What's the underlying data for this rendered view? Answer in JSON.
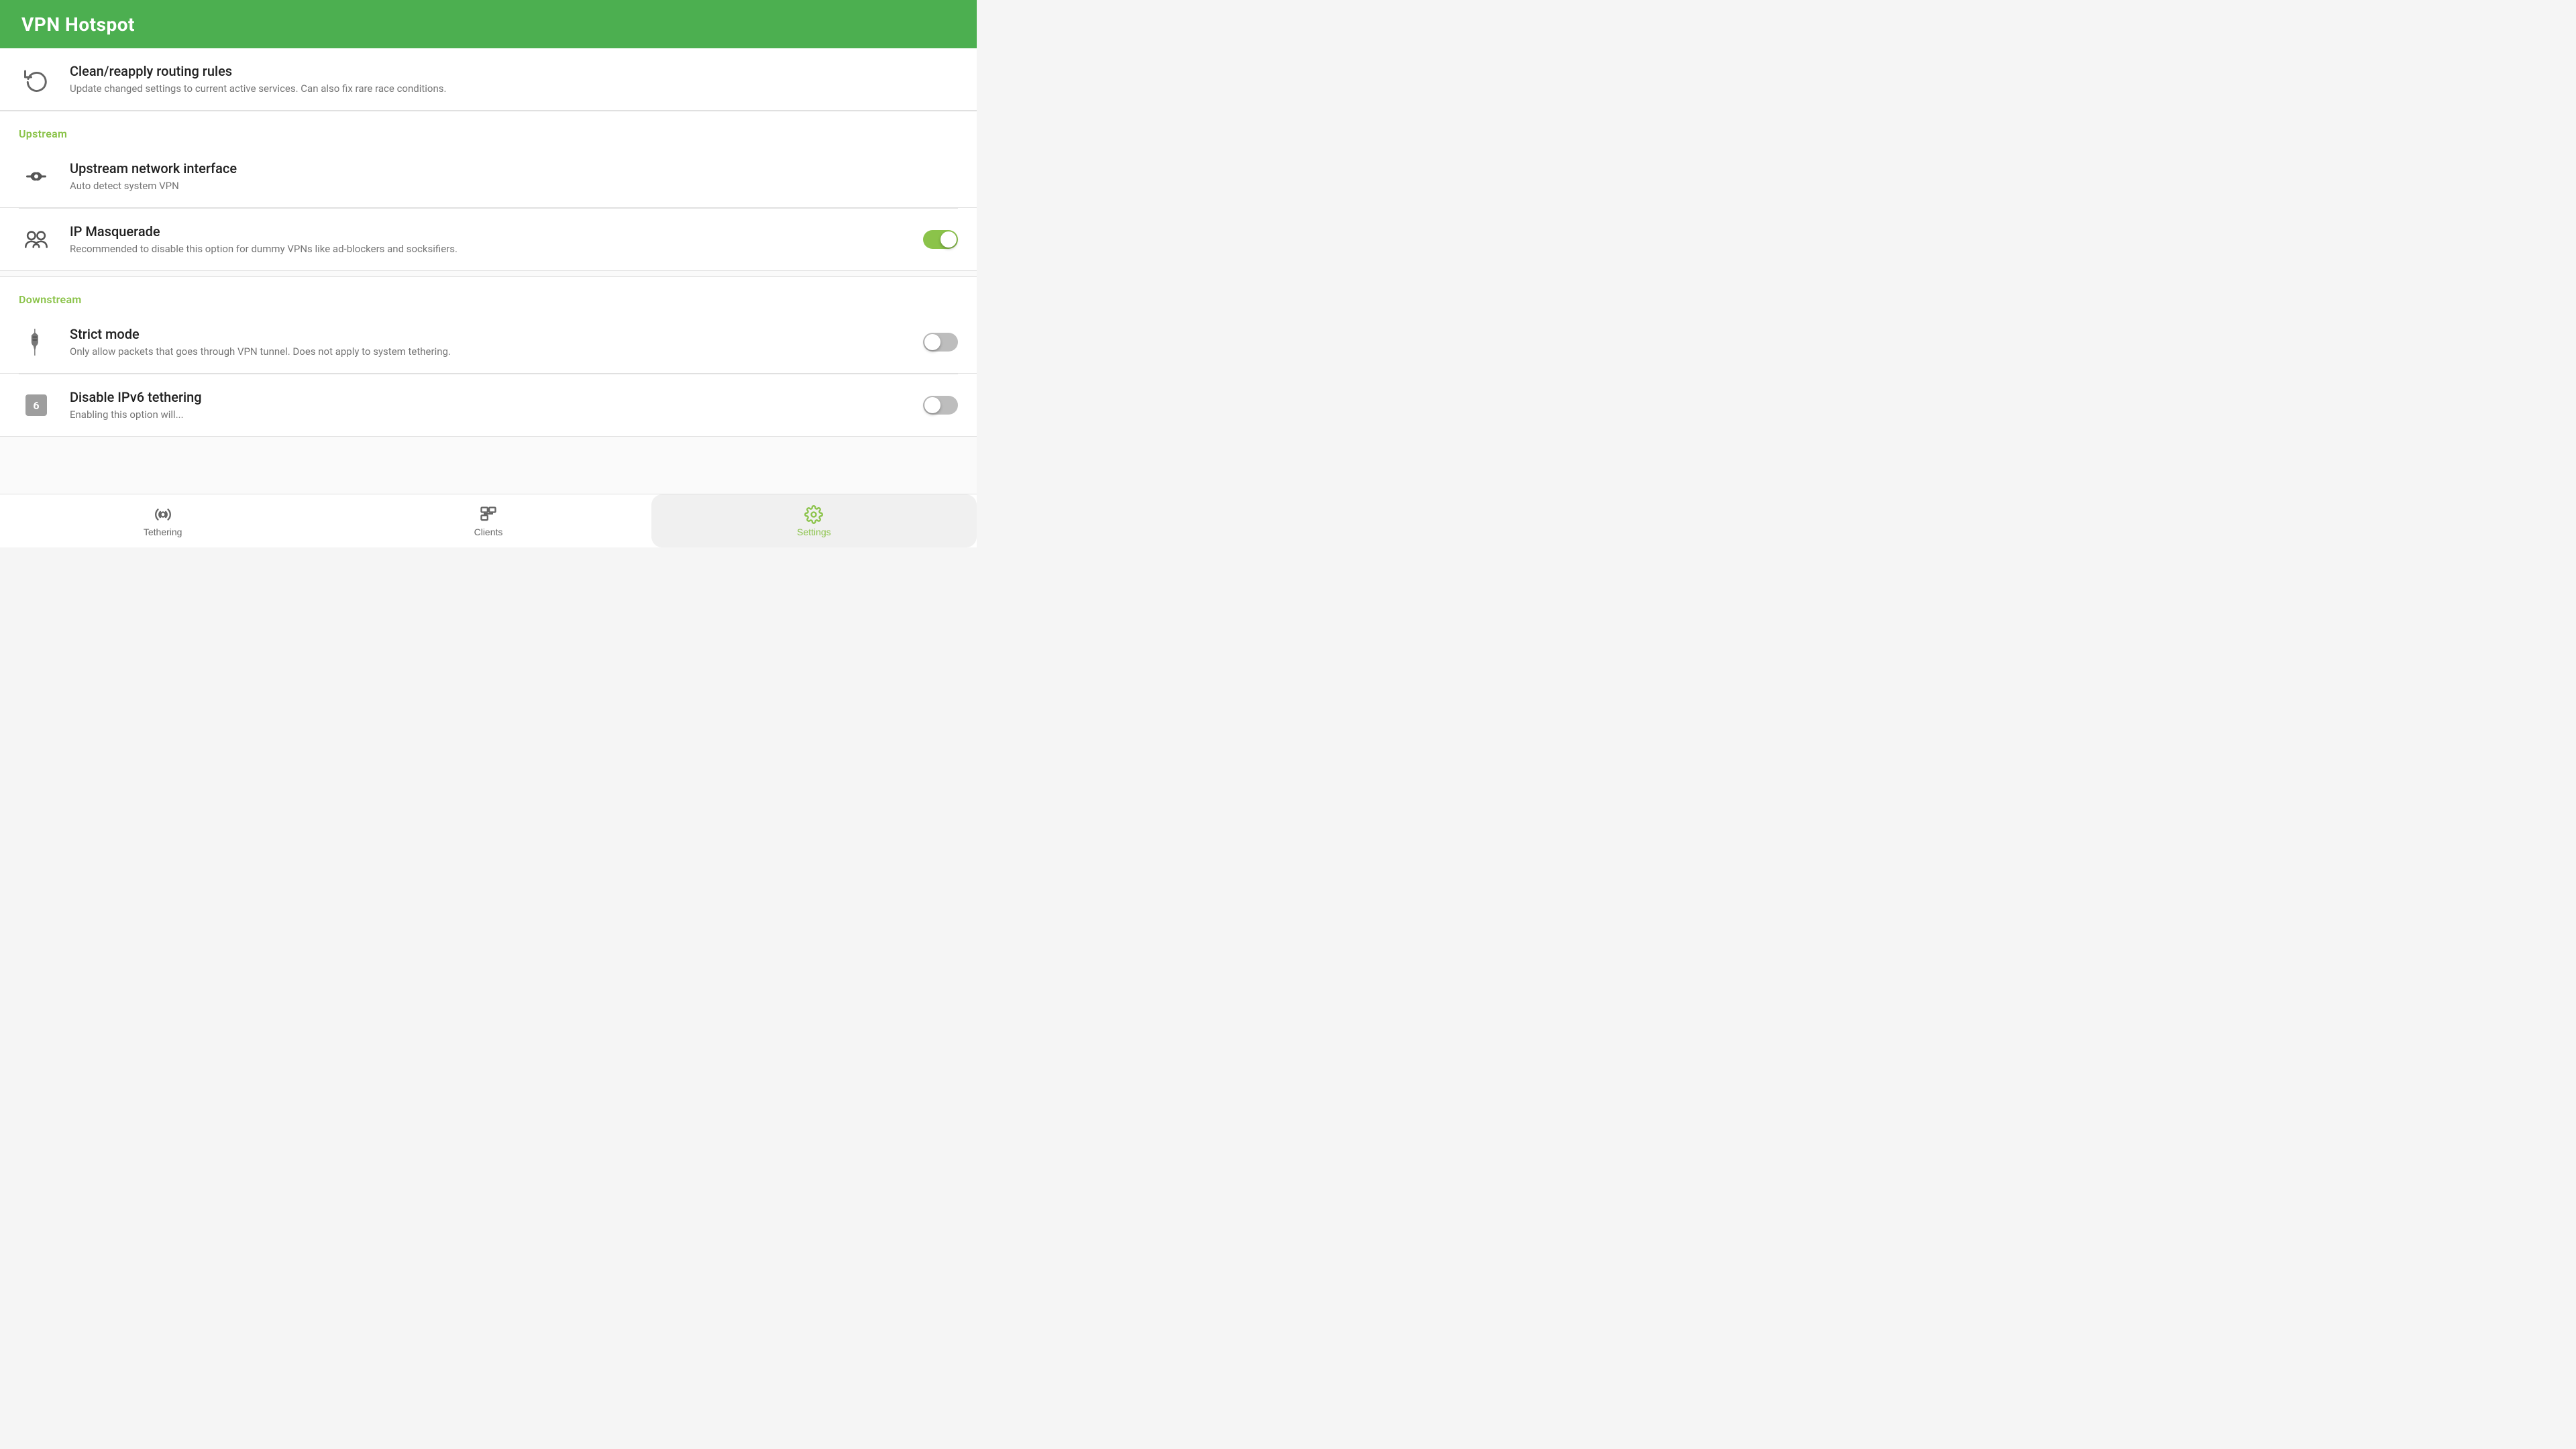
{
  "appBar": {
    "title": "VPN Hotspot"
  },
  "listItems": {
    "cleanReapply": {
      "title": "Clean/reapply routing rules",
      "subtitle": "Update changed settings to current active services. Can also fix rare race conditions."
    },
    "upstream": {
      "sectionTitle": "Upstream",
      "networkInterface": {
        "title": "Upstream network interface",
        "subtitle": "Auto detect system VPN"
      },
      "ipMasquerade": {
        "title": "IP Masquerade",
        "subtitle": "Recommended to disable this option for dummy VPNs like ad-blockers and socksifiers.",
        "toggleOn": true
      }
    },
    "downstream": {
      "sectionTitle": "Downstream",
      "strictMode": {
        "title": "Strict mode",
        "subtitle": "Only allow packets that goes through VPN tunnel. Does not apply to system tethering.",
        "toggleOn": false
      },
      "disableIPv6": {
        "title": "Disable IPv6 tethering",
        "subtitle": "Enabling this option will...",
        "toggleOn": false,
        "badgeNumber": "6"
      }
    }
  },
  "bottomNav": {
    "items": [
      {
        "id": "tethering",
        "label": "Tethering",
        "active": false
      },
      {
        "id": "clients",
        "label": "Clients",
        "active": false
      },
      {
        "id": "settings",
        "label": "Settings",
        "active": true
      }
    ]
  }
}
